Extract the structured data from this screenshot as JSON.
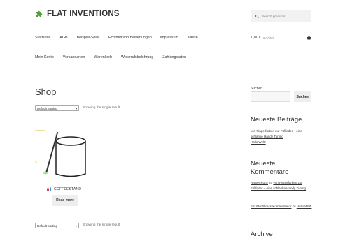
{
  "header": {
    "logo_text": "FLAT INVENTIONS",
    "search_placeholder": "Search products...",
    "cart_amount": "0,00 €",
    "cart_count": "0 Artikel"
  },
  "nav_primary": [
    "Startseite",
    "AGB",
    "Beispiel-Seite",
    "Echtheit von Bewertungen",
    "Impressum",
    "Kasse"
  ],
  "nav_secondary": [
    "Mein Konto",
    "Versandarten",
    "Warenkorb",
    "Widerrufsbelehrung",
    "Zahlungsarten"
  ],
  "main": {
    "title": "Shop",
    "sorting_value": "Default sorting",
    "result_count": "Showing the single result",
    "product": {
      "title": "COFFEESTAND",
      "button": "Read more",
      "img_label": "Ständer"
    }
  },
  "sidebar": {
    "search_label": "Suchen",
    "search_button": "Suchen",
    "recent_posts_title": "Neueste Beiträge",
    "recent_post": "von Fingerfarben zur Füllfeder – eine schlanke Handy Tuning",
    "hello_world": "Hallo Welt!",
    "recent_comments_title_1": "Neueste",
    "recent_comments_title_2": "Kommentare",
    "comment1_author": "Rainer Kurtz",
    "comment1_zu": "zu",
    "comment1_post": "von Fingerfarben zur Füllfeder – eine schlanke Handy Tuning",
    "comment2_author": "Ein WordPress-Kommentator",
    "comment2_zu": "zu",
    "comment2_post": "Hallo Welt!",
    "archive_title": "Archive"
  },
  "colors": {
    "logo_green": "#52a03c",
    "text": "#333333",
    "button_bg": "#eeeeee"
  }
}
